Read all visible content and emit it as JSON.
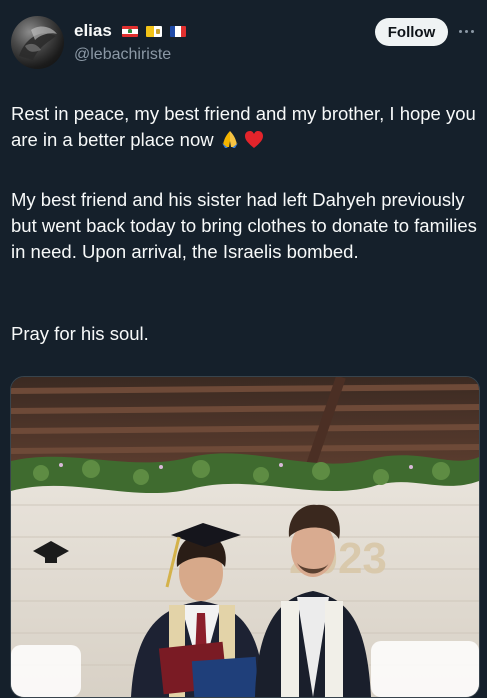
{
  "tweet": {
    "author": {
      "name": "elias",
      "handle": "@lebachiriste",
      "flags": [
        "lebanon-flag",
        "vatican-flag",
        "france-flag"
      ]
    },
    "follow_label": "Follow",
    "paragraphs": [
      "Rest in peace, my best friend and my brother, I hope you are in a better place now",
      "My best friend and his sister had left Dahyeh previously but went back today to bring clothes to donate to families in need. Upon arrival, the Israelis bombed.",
      "Pray for his soul."
    ],
    "emojis": [
      "folded-hands-icon",
      "red-heart-icon"
    ],
    "photo": {
      "backdrop_text": "2023"
    }
  },
  "colors": {
    "background": "#15202b",
    "text": "#f7f9f9",
    "secondary": "#8b98a5",
    "follow_bg": "#eff3f4"
  }
}
